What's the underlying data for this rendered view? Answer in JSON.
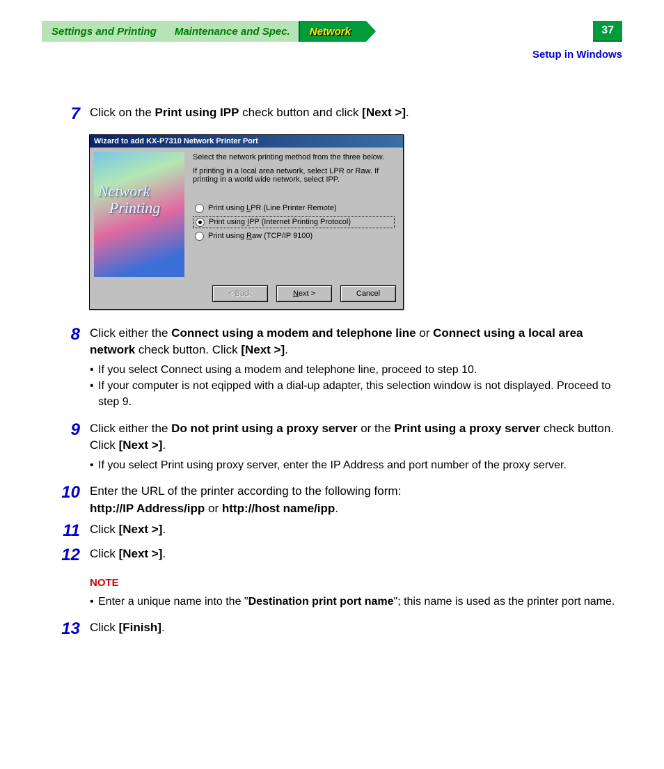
{
  "header": {
    "tabs": [
      {
        "label": "Settings and Printing"
      },
      {
        "label": "Maintenance and Spec."
      },
      {
        "label": "Network"
      }
    ],
    "page_number": "37",
    "subhead": "Setup in Windows"
  },
  "dialog": {
    "title": "Wizard to add KX-P7310 Network Printer Port",
    "img_line1": "Network",
    "img_line2": "Printing",
    "instr1": "Select the network printing method from the three below.",
    "instr2": "If printing in a local area network, select LPR or Raw. If printing in a world wide network, select IPP.",
    "radios": [
      {
        "label_pre": "Print using ",
        "key": "L",
        "label_post": "PR (Line Printer Remote)",
        "checked": false
      },
      {
        "label_pre": "Print using ",
        "key": "I",
        "label_post": "PP (Internet Printing Protocol)",
        "checked": true
      },
      {
        "label_pre": "Print using ",
        "key": "R",
        "label_post": "aw (TCP/IP 9100)",
        "checked": false
      }
    ],
    "buttons": {
      "back": "< Back",
      "next_pre": "N",
      "next_rest": "ext >",
      "cancel": "Cancel"
    }
  },
  "steps": {
    "s7": {
      "num": "7",
      "pre": "Click on the ",
      "b1": "Print using IPP",
      "mid": " check button and click ",
      "b2": "[Next >]",
      "post": "."
    },
    "s8": {
      "num": "8",
      "pre": "Click either the ",
      "b1": "Connect using a modem and telephone line",
      "mid1": " or ",
      "b2": "Connect using a local area network",
      "mid2": " check button. Click ",
      "b3": "[Next >]",
      "post": ".",
      "bullets": [
        "If you select Connect using a modem and telephone line, proceed to step 10.",
        "If your computer is not eqipped with a dial-up adapter, this selection window is not displayed. Proceed to step 9."
      ]
    },
    "s9": {
      "num": "9",
      "pre": "Click either the ",
      "b1": "Do not print using a proxy server",
      "mid1": " or the ",
      "b2": "Print using a proxy server",
      "mid2": " check button. Click ",
      "b3": "[Next >]",
      "post": ".",
      "bullets": [
        "If you select Print using proxy server, enter the IP Address and port number of the proxy server."
      ]
    },
    "s10": {
      "num": "10",
      "pre": "Enter the URL of the printer according to the following form:",
      "b1": "http://IP Address/ipp",
      "mid": " or ",
      "b2": "http://host name/ipp",
      "post": "."
    },
    "s11": {
      "num": "11",
      "pre": "Click ",
      "b1": "[Next >]",
      "post": "."
    },
    "s12": {
      "num": "12",
      "pre": "Click ",
      "b1": "[Next >]",
      "post": "."
    },
    "note": {
      "label": "NOTE",
      "pre": "Enter a unique name into the \"",
      "b1": "Destination print port name",
      "post": "\"; this name is used as the printer port name."
    },
    "s13": {
      "num": "13",
      "pre": "Click ",
      "b1": "[Finish]",
      "post": "."
    }
  }
}
